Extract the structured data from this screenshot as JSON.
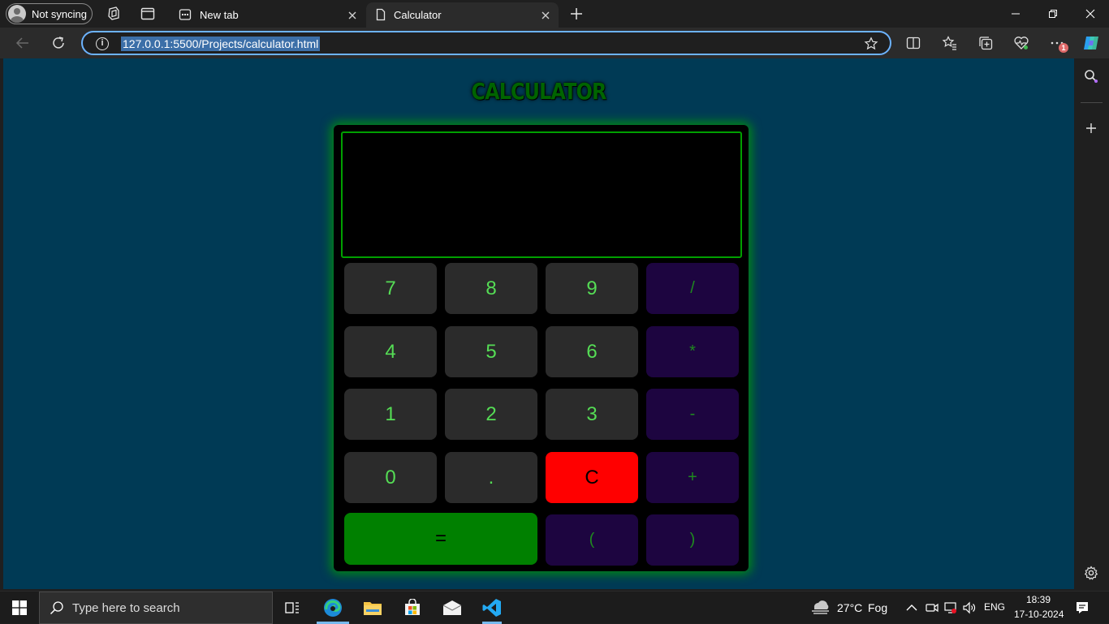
{
  "browser": {
    "profile_label": "Not syncing",
    "tabs": [
      {
        "title": "New tab",
        "active": false
      },
      {
        "title": "Calculator",
        "active": true
      }
    ],
    "address_url": "127.0.0.1:5500/Projects/calculator.html",
    "notification_badge": "1"
  },
  "page": {
    "title": "CALCULATOR",
    "display_value": "",
    "keys": {
      "k7": "7",
      "k8": "8",
      "k9": "9",
      "div": "/",
      "k4": "4",
      "k5": "5",
      "k6": "6",
      "mul": "*",
      "k1": "1",
      "k2": "2",
      "k3": "3",
      "sub": "-",
      "k0": "0",
      "dot": ".",
      "clear": "C",
      "add": "+",
      "equals": "=",
      "lparen": "(",
      "rparen": ")"
    }
  },
  "taskbar": {
    "search_placeholder": "Type here to search",
    "weather_temp": "27°C",
    "weather_cond": "Fog",
    "language": "ENG",
    "time": "18:39",
    "date": "17-10-2024"
  },
  "colors": {
    "page_bg": "#003a55",
    "number_key_bg": "#2b2b2b",
    "operator_key_bg": "#1d0540",
    "clear_key_bg": "#ff0000",
    "equals_key_bg": "#008000",
    "accent_green": "#00a000"
  }
}
